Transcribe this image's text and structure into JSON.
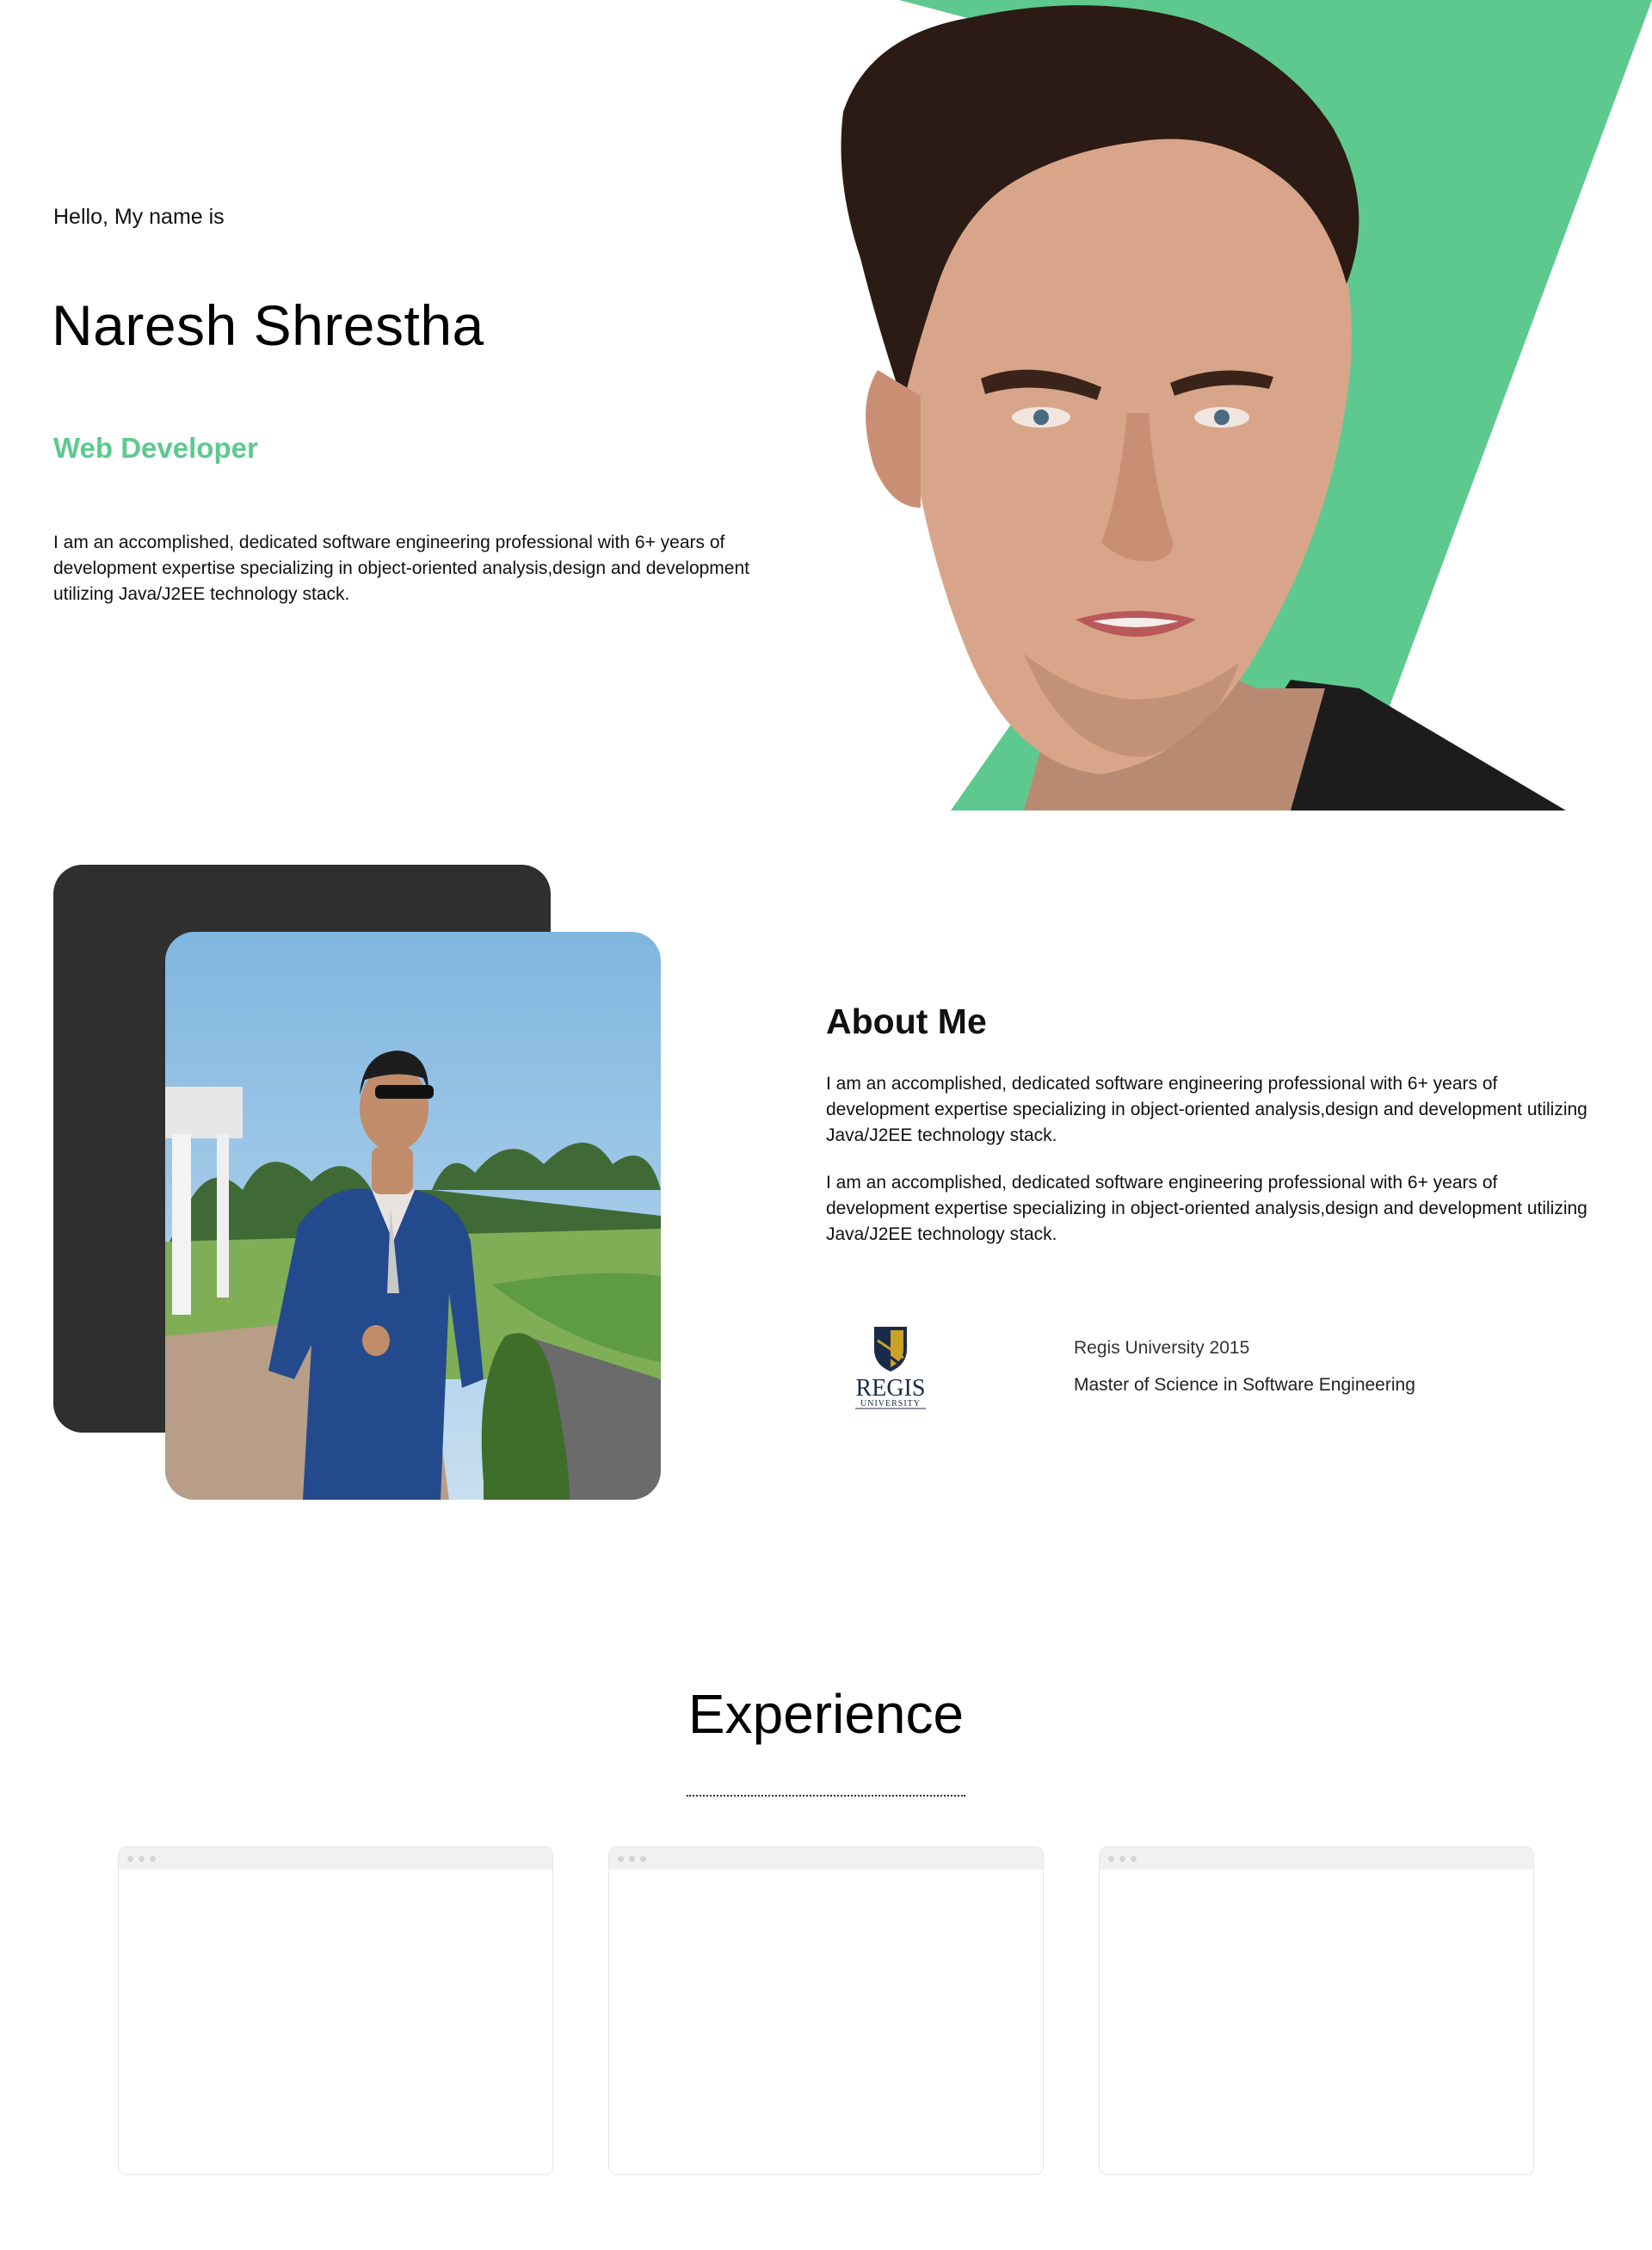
{
  "hero": {
    "greeting": "Hello, My name is",
    "name": "Naresh Shrestha",
    "role": "Web Developer",
    "bio": "I am an accomplished, dedicated software engineering professional with 6+ years of development expertise specializing in object-oriented analysis,design and development utilizing Java/J2EE technology stack.",
    "accent_color": "#5ec98e",
    "portrait_icon": "person-portrait"
  },
  "about": {
    "title": "About Me",
    "paragraphs": [
      "I am an accomplished, dedicated software engineering professional with 6+ years of development expertise specializing in object-oriented analysis,design and development utilizing Java/J2EE technology stack.",
      "I am an accomplished, dedicated software engineering professional with 6+ years of development expertise specializing in object-oriented analysis,design and development utilizing Java/J2EE technology stack."
    ],
    "photo_icon": "person-in-suit-photo",
    "card_color": "#2f2f2f",
    "education": {
      "logo_text": "REGIS",
      "logo_subtext": "UNIVERSITY",
      "school": "Regis University 2015",
      "degree": "Master of Science in Software Engineering",
      "logo_navy": "#1b2a4a",
      "logo_gold": "#c9a227"
    }
  },
  "experience": {
    "title": "Experience",
    "cards": [
      {
        "id": "card-1"
      },
      {
        "id": "card-2"
      },
      {
        "id": "card-3"
      }
    ]
  }
}
